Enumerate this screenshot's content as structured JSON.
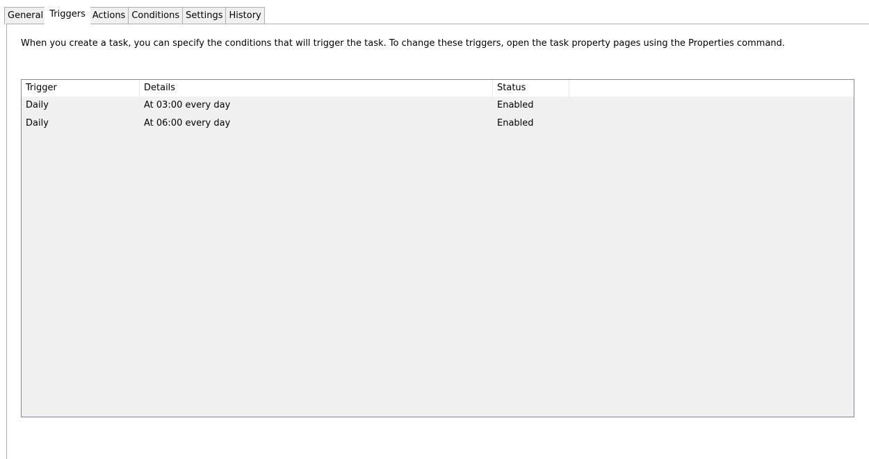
{
  "tabs": [
    {
      "label": "General",
      "active": false
    },
    {
      "label": "Triggers",
      "active": true
    },
    {
      "label": "Actions",
      "active": false
    },
    {
      "label": "Conditions",
      "active": false
    },
    {
      "label": "Settings",
      "active": false
    },
    {
      "label": "History",
      "active": false
    }
  ],
  "description": "When you create a task, you can specify the conditions that will trigger the task.  To change these triggers, open the task property pages using the Properties command.",
  "grid": {
    "columns": [
      "Trigger",
      "Details",
      "Status"
    ],
    "rows": [
      {
        "trigger": "Daily",
        "details": "At 03:00 every day",
        "status": "Enabled"
      },
      {
        "trigger": "Daily",
        "details": "At 06:00 every day",
        "status": "Enabled"
      }
    ]
  },
  "colors": {
    "list_background": "#f0f0f0",
    "border": "#adadad"
  }
}
